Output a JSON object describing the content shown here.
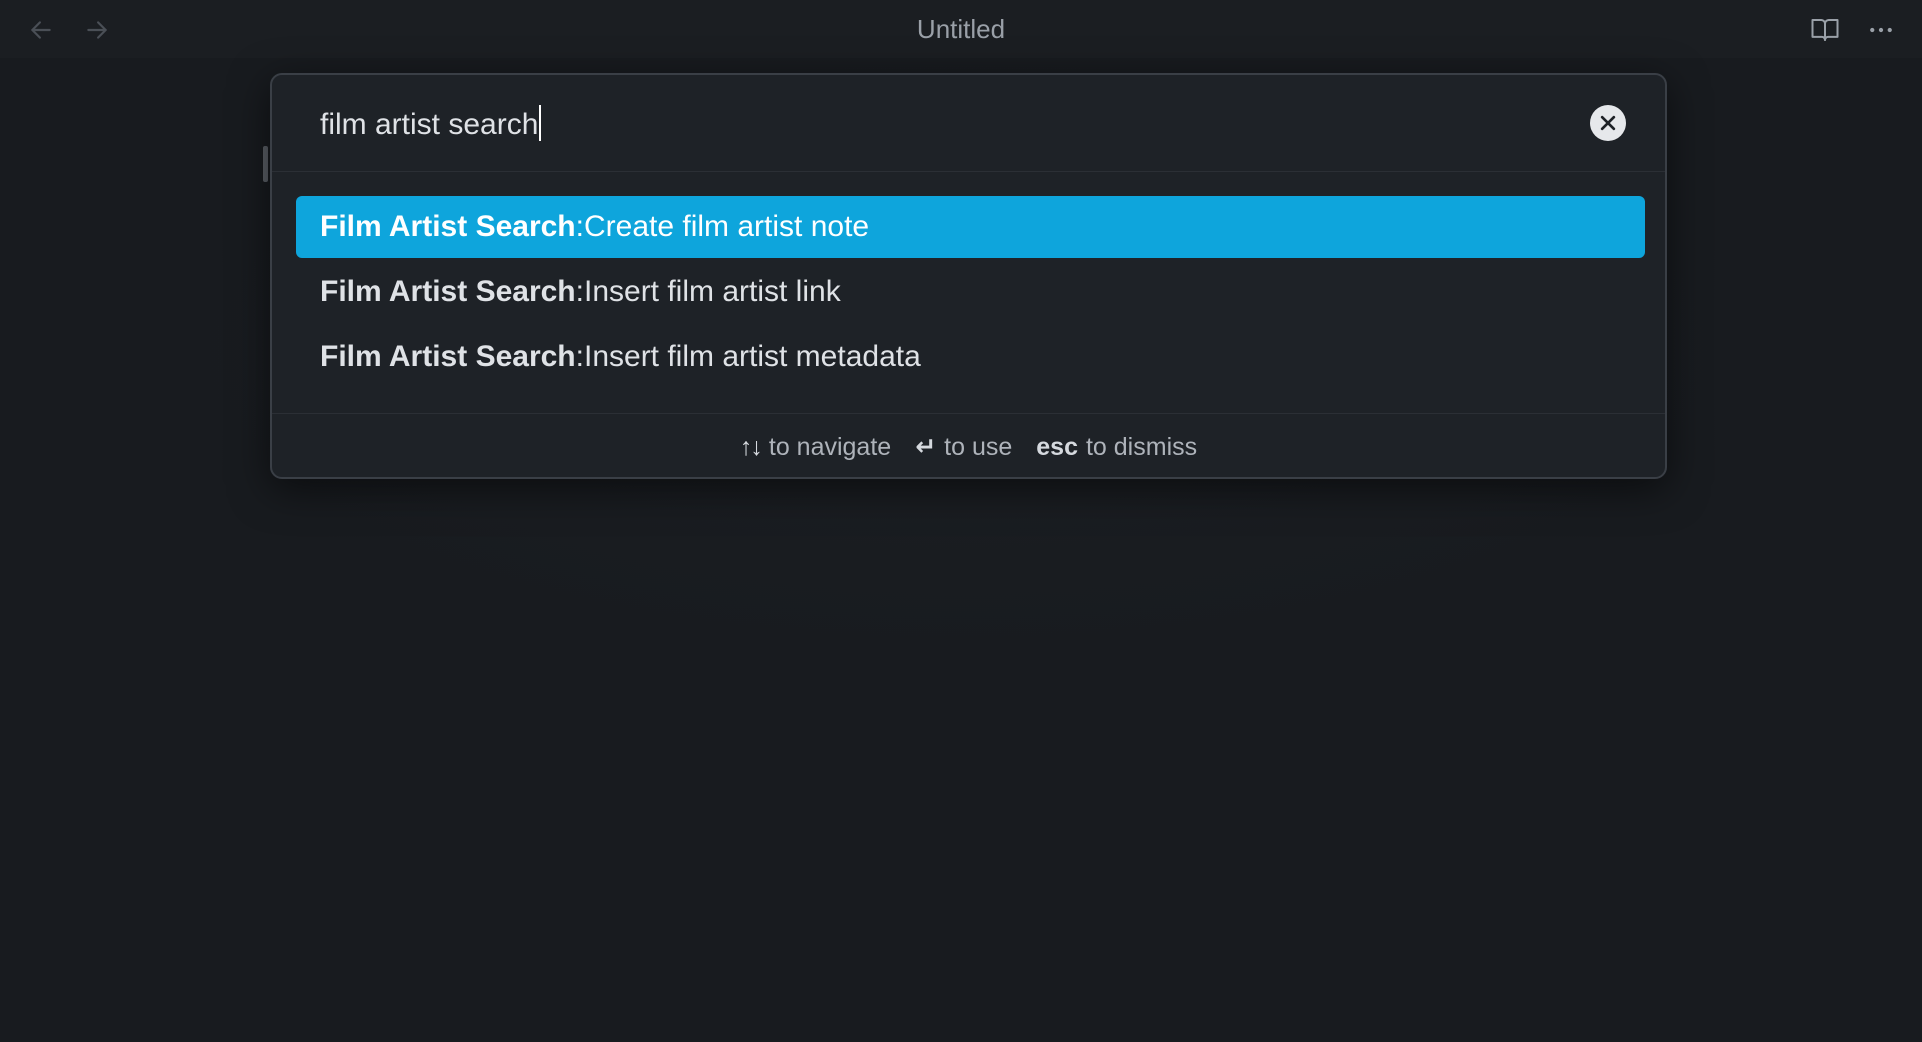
{
  "window": {
    "title": "Untitled"
  },
  "colors": {
    "background": "#181b1f",
    "palette_bg": "#1e2227",
    "accent": "#0ea5dc",
    "text": "#dfe2e6",
    "muted": "#9aa0a8"
  },
  "icons": {
    "back": "arrow-left-icon",
    "forward": "arrow-right-icon",
    "reading": "book-open-icon",
    "more": "more-horizontal-icon",
    "clear": "close-icon"
  },
  "palette": {
    "query": "film artist search",
    "results": [
      {
        "prefix": "Film Artist Search",
        "sep": ": ",
        "label": "Create film artist note",
        "selected": true
      },
      {
        "prefix": "Film Artist Search",
        "sep": ": ",
        "label": "Insert film artist link",
        "selected": false
      },
      {
        "prefix": "Film Artist Search",
        "sep": ": ",
        "label": "Insert film artist metadata",
        "selected": false
      }
    ],
    "hints": [
      {
        "key": "↑↓",
        "text": "to navigate"
      },
      {
        "key": "↵",
        "text": "to use"
      },
      {
        "key": "esc",
        "text": "to dismiss"
      }
    ]
  }
}
